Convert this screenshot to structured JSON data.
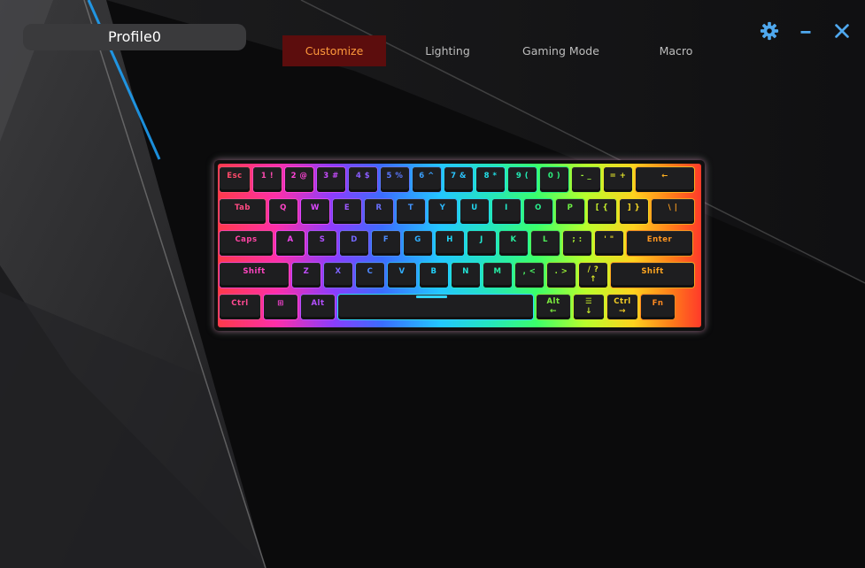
{
  "profile": {
    "name": "Profile0"
  },
  "tabs": [
    {
      "label": "Customize",
      "active": true
    },
    {
      "label": "Lighting",
      "active": false
    },
    {
      "label": "Gaming Mode",
      "active": false
    },
    {
      "label": "Macro",
      "active": false
    }
  ],
  "window_controls": {
    "settings_icon": "gear-icon",
    "minimize_icon": "minimize-icon",
    "close_icon": "close-icon"
  },
  "colors": {
    "accent": "#4fa8ee",
    "active_tab_bg": "#5c0d0d",
    "active_tab_text": "#ff9a3c",
    "profile_bg": "#3a3a3c"
  },
  "keyboard": {
    "rows": [
      [
        {
          "id": "esc",
          "label": "Esc",
          "color": "#ff4a6a"
        },
        {
          "id": "1",
          "label": "1 !",
          "color": "#ff4ab0"
        },
        {
          "id": "2",
          "label": "2 @",
          "color": "#ff44d8"
        },
        {
          "id": "3",
          "label": "3 #",
          "color": "#c84cff"
        },
        {
          "id": "4",
          "label": "4 $",
          "color": "#8a5cff"
        },
        {
          "id": "5",
          "label": "5 %",
          "color": "#5a78ff"
        },
        {
          "id": "6",
          "label": "6 ^",
          "color": "#3aa2ff"
        },
        {
          "id": "7",
          "label": "7 &",
          "color": "#2ac6ff"
        },
        {
          "id": "8",
          "label": "8 *",
          "color": "#22e0e8"
        },
        {
          "id": "9",
          "label": "9 (",
          "color": "#22ecb6"
        },
        {
          "id": "0",
          "label": "0 )",
          "color": "#2cf07c"
        },
        {
          "id": "minus",
          "label": "- _",
          "color": "#9cf03a"
        },
        {
          "id": "equal",
          "label": "= +",
          "color": "#e6e82a"
        },
        {
          "id": "backspace",
          "label": "←",
          "color": "#ffb020"
        }
      ],
      [
        {
          "id": "tab",
          "label": "Tab",
          "color": "#ff4a82"
        },
        {
          "id": "q",
          "label": "Q",
          "color": "#ff44c8"
        },
        {
          "id": "w",
          "label": "W",
          "color": "#dd48ff"
        },
        {
          "id": "e",
          "label": "E",
          "color": "#9e58ff"
        },
        {
          "id": "r",
          "label": "R",
          "color": "#6a70ff"
        },
        {
          "id": "t",
          "label": "T",
          "color": "#4294ff"
        },
        {
          "id": "y",
          "label": "Y",
          "color": "#2cbaff"
        },
        {
          "id": "u",
          "label": "U",
          "color": "#22d8f0"
        },
        {
          "id": "i",
          "label": "I",
          "color": "#22eac8"
        },
        {
          "id": "o",
          "label": "O",
          "color": "#28f08e"
        },
        {
          "id": "p",
          "label": "P",
          "color": "#6cf044"
        },
        {
          "id": "lbracket",
          "label": "[ {",
          "color": "#c4ee2c"
        },
        {
          "id": "rbracket",
          "label": "] }",
          "color": "#f6d824"
        },
        {
          "id": "backslash",
          "label": "\\ |",
          "color": "#ffa020"
        }
      ],
      [
        {
          "id": "caps",
          "label": "Caps",
          "color": "#ff44a4"
        },
        {
          "id": "a",
          "label": "A",
          "color": "#f046ec"
        },
        {
          "id": "s",
          "label": "S",
          "color": "#b050ff"
        },
        {
          "id": "d",
          "label": "D",
          "color": "#7468ff"
        },
        {
          "id": "f",
          "label": "F",
          "color": "#4c8cff"
        },
        {
          "id": "g",
          "label": "G",
          "color": "#30b0ff"
        },
        {
          "id": "h",
          "label": "H",
          "color": "#22d4f4"
        },
        {
          "id": "j",
          "label": "J",
          "color": "#22e8d2"
        },
        {
          "id": "k",
          "label": "K",
          "color": "#26ee9e"
        },
        {
          "id": "l",
          "label": "L",
          "color": "#4ef05a"
        },
        {
          "id": "semicolon",
          "label": "; :",
          "color": "#a6ee32"
        },
        {
          "id": "quote",
          "label": "' \"",
          "color": "#eee028"
        },
        {
          "id": "enter",
          "label": "Enter",
          "color": "#ff9620"
        }
      ],
      [
        {
          "id": "lshift",
          "label": "Shift",
          "color": "#ff44c0"
        },
        {
          "id": "z",
          "label": "Z",
          "color": "#c24eff"
        },
        {
          "id": "x",
          "label": "X",
          "color": "#7e64ff"
        },
        {
          "id": "c",
          "label": "C",
          "color": "#4e88ff"
        },
        {
          "id": "v",
          "label": "V",
          "color": "#32aeff"
        },
        {
          "id": "b",
          "label": "B",
          "color": "#22d0f8"
        },
        {
          "id": "n",
          "label": "N",
          "color": "#22e6d8"
        },
        {
          "id": "m",
          "label": "M",
          "color": "#26eea6"
        },
        {
          "id": "comma",
          "label": ", <",
          "color": "#4af062"
        },
        {
          "id": "period",
          "label": ". >",
          "color": "#96ee36"
        },
        {
          "id": "slash",
          "label": "/ ?",
          "sub": "↑",
          "color": "#dcea2a"
        },
        {
          "id": "rshift",
          "label": "Shift",
          "color": "#ffa620"
        }
      ],
      [
        {
          "id": "lctrl",
          "label": "Ctrl",
          "color": "#ff4a92"
        },
        {
          "id": "win",
          "label": "⊞",
          "color": "#ff44d8"
        },
        {
          "id": "lalt",
          "label": "Alt",
          "color": "#b450ff"
        },
        {
          "id": "space",
          "label": "",
          "color": "#30d5ff"
        },
        {
          "id": "ralt",
          "label": "Alt",
          "sub": "←",
          "color": "#7cee3e"
        },
        {
          "id": "menu",
          "label": "☰",
          "sub": "↓",
          "color": "#c8ec2c"
        },
        {
          "id": "rctrl",
          "label": "Ctrl",
          "sub": "→",
          "color": "#f2cc24"
        },
        {
          "id": "fn",
          "label": "Fn",
          "color": "#ff8a20"
        }
      ]
    ]
  }
}
